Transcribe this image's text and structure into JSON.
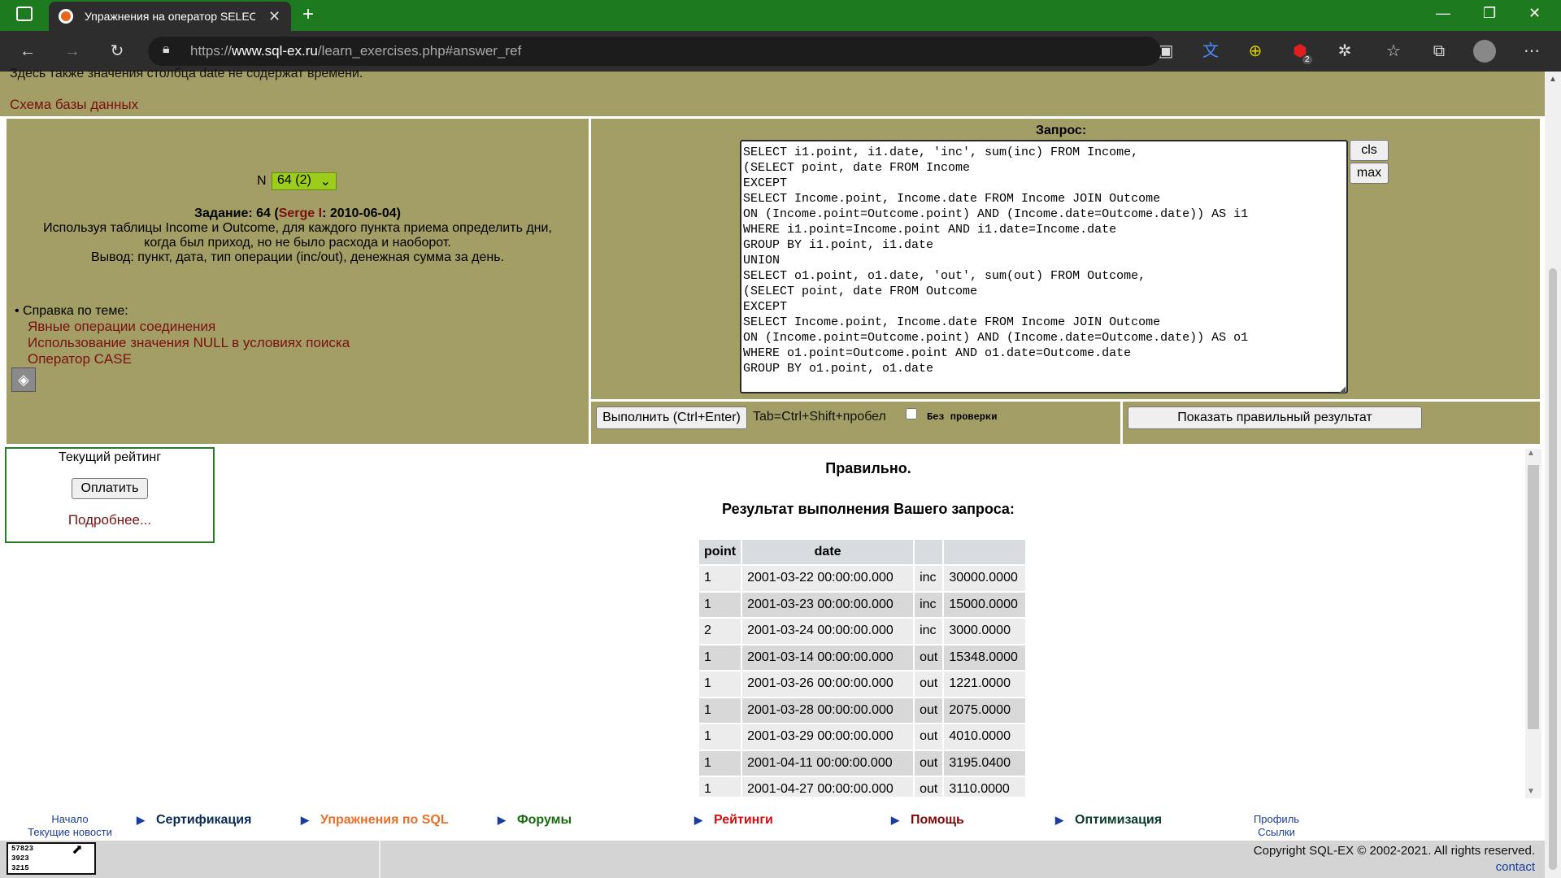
{
  "browser": {
    "tab_title": "Упражнения на оператор SELEC",
    "url_prefix": "https://",
    "url_host": "www.sql-ex.ru",
    "url_path": "/learn_exercises.php#answer_ref",
    "badge_count": "2"
  },
  "top": {
    "note": "Здесь также значения столбца date не содержат времени.",
    "schema_link": "Схема базы данных"
  },
  "exercise": {
    "n_label": "N",
    "n_selected": "64 (2)",
    "task_prefix": "Задание: 64 (",
    "author": "Serge I",
    "task_suffix": ": 2010-06-04)",
    "desc_line1": "Используя таблицы Income и Outcome, для каждого пункта приема определить дни,",
    "desc_line2": "когда был приход, но не было расхода и наоборот.",
    "desc_line3": "Вывод: пункт, дата, тип операции (inc/out), денежная сумма за день.",
    "help_title": "Справка по теме:",
    "help_links": [
      "Явные операции соединения",
      "Использование значения NULL в условиях поиска",
      "Оператор CASE"
    ]
  },
  "query": {
    "label": "Запрос:",
    "text": "SELECT i1.point, i1.date, 'inc', sum(inc) FROM Income,\n(SELECT point, date FROM Income\nEXCEPT\nSELECT Income.point, Income.date FROM Income JOIN Outcome\nON (Income.point=Outcome.point) AND (Income.date=Outcome.date)) AS i1\nWHERE i1.point=Income.point AND i1.date=Income.date\nGROUP BY i1.point, i1.date\nUNION\nSELECT o1.point, o1.date, 'out', sum(out) FROM Outcome,\n(SELECT point, date FROM Outcome\nEXCEPT\nSELECT Income.point, Income.date FROM Income JOIN Outcome\nON (Income.point=Outcome.point) AND (Income.date=Outcome.date)) AS o1\nWHERE o1.point=Outcome.point AND o1.date=Outcome.date\nGROUP BY o1.point, o1.date",
    "cls_label": "cls",
    "max_label": "max",
    "run_label": "Выполнить (Ctrl+Enter)",
    "tab_hint": "Tab=Ctrl+Shift+пробел",
    "no_check_label": "Без проверки",
    "no_check_checked": false,
    "show_result_label": "Показать правильный результат"
  },
  "rating": {
    "title": "Текущий рейтинг",
    "pay_label": "Оплатить",
    "more_label": "Подробнее..."
  },
  "result": {
    "status": "Правильно.",
    "heading": "Результат выполнения Вашего запроса:",
    "columns": [
      "point",
      "date",
      "",
      ""
    ],
    "rows": [
      [
        "1",
        "2001-03-22 00:00:00.000",
        "inc",
        "30000.0000"
      ],
      [
        "1",
        "2001-03-23 00:00:00.000",
        "inc",
        "15000.0000"
      ],
      [
        "2",
        "2001-03-24 00:00:00.000",
        "inc",
        "3000.0000"
      ],
      [
        "1",
        "2001-03-14 00:00:00.000",
        "out",
        "15348.0000"
      ],
      [
        "1",
        "2001-03-26 00:00:00.000",
        "out",
        "1221.0000"
      ],
      [
        "1",
        "2001-03-28 00:00:00.000",
        "out",
        "2075.0000"
      ],
      [
        "1",
        "2001-03-29 00:00:00.000",
        "out",
        "4010.0000"
      ],
      [
        "1",
        "2001-04-11 00:00:00.000",
        "out",
        "3195.0400"
      ],
      [
        "1",
        "2001-04-27 00:00:00.000",
        "out",
        "3110.0000"
      ]
    ]
  },
  "footer": {
    "home": "Начало",
    "news": "Текущие новости",
    "nav": [
      {
        "label": "Сертификация",
        "color": "#0a2a5a"
      },
      {
        "label": "Упражнения по SQL",
        "color": "#e8702a"
      },
      {
        "label": "Форумы",
        "color": "#1a6a10"
      },
      {
        "label": "Рейтинги",
        "color": "#d01010"
      },
      {
        "label": "Помощь",
        "color": "#7a0a0a"
      },
      {
        "label": "Оптимизация",
        "color": "#0a3a2a"
      }
    ],
    "profile": "Профиль",
    "links": "Ссылки",
    "counter": [
      "57823",
      "3923",
      "3215"
    ],
    "copyright": "Copyright SQL-EX © 2002-2021. All rights reserved.",
    "contact": "contact"
  }
}
